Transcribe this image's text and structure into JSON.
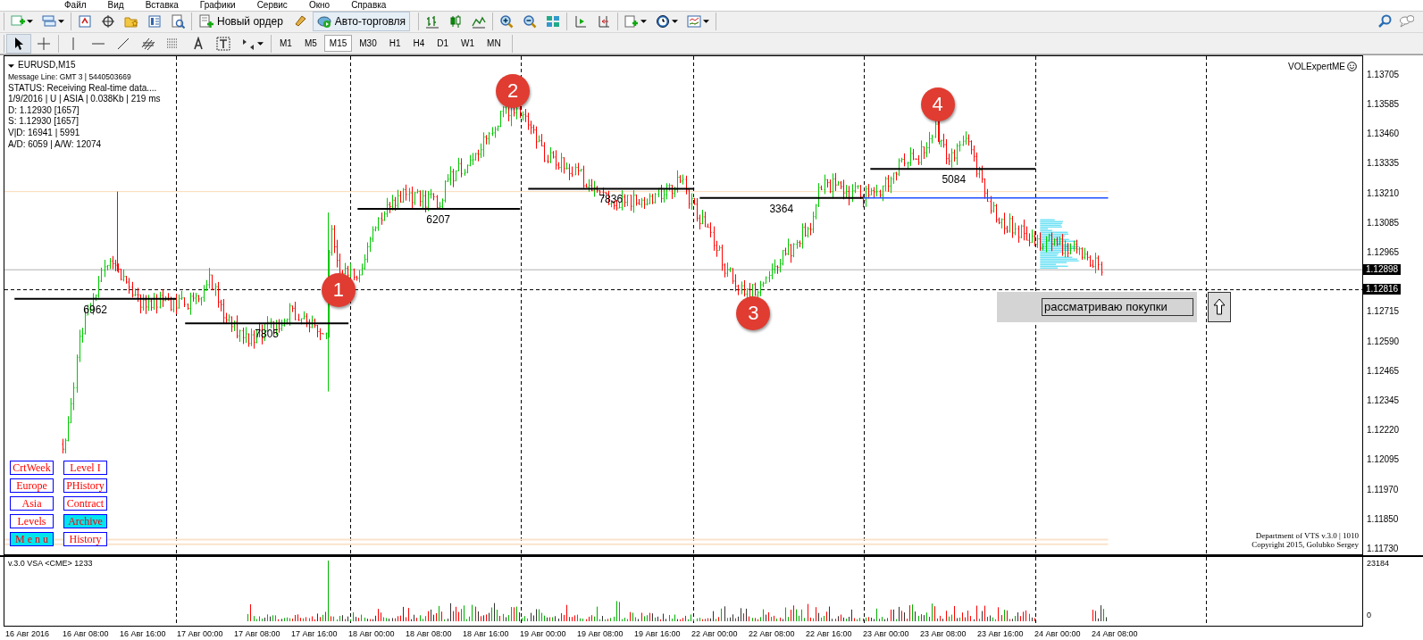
{
  "menu": [
    "Файл",
    "Вид",
    "Вставка",
    "Графики",
    "Сервис",
    "Окно",
    "Справка"
  ],
  "toolbar": {
    "new_order": "Новый ордер",
    "auto_trading": "Авто-торговля",
    "timeframes": [
      {
        "label": "M1",
        "selected": false
      },
      {
        "label": "M5",
        "selected": false
      },
      {
        "label": "M15",
        "selected": true
      },
      {
        "label": "M30",
        "selected": false
      },
      {
        "label": "H1",
        "selected": false
      },
      {
        "label": "H4",
        "selected": false
      },
      {
        "label": "D1",
        "selected": false
      },
      {
        "label": "W1",
        "selected": false
      },
      {
        "label": "MN",
        "selected": false
      }
    ]
  },
  "chart": {
    "symbol": "EURUSD,M15",
    "info_lines": [
      {
        "kind": "small",
        "text": "Message Line: GMT 3 | 5440503669"
      },
      {
        "kind": "normal",
        "text": "STATUS:  Receiving Real-time data...."
      },
      {
        "kind": "normal",
        "text": "1/9/2016 | U | ASIA | 0.038Kb | 219 ms"
      },
      {
        "kind": "normal",
        "text": "D: 1.12930  [1657]"
      },
      {
        "kind": "normal",
        "text": "S: 1.12930  [1657]"
      },
      {
        "kind": "normal",
        "text": "V|D: 16941 | 5991"
      },
      {
        "kind": "normal",
        "text": "A/D: 6059 | A/W: 12074"
      }
    ],
    "indicator": "VOLExpertME",
    "credits": [
      "Department of VTS  v.3.0 | 1010",
      "Copyright 2015, Golubko Sergey"
    ],
    "price_ticks": [
      "1.13705",
      "1.13585",
      "1.13460",
      "1.13335",
      "1.13210",
      "1.13085",
      "1.12965",
      "1.12715",
      "1.12590",
      "1.12465",
      "1.12345",
      "1.12220",
      "1.12095",
      "1.11970",
      "1.11850",
      "1.11730"
    ],
    "current_price": "1.12898",
    "line_price": "1.12816",
    "levels": [
      "6962",
      "7805",
      "6207",
      "7836",
      "3364",
      "5084"
    ],
    "markers": [
      "1",
      "2",
      "3",
      "4"
    ],
    "note": {
      "value": "рассматриваю покупки"
    },
    "buttons": [
      {
        "label": "CrtWeek",
        "active": false
      },
      {
        "label": "Level I",
        "active": false
      },
      {
        "label": "Europe",
        "active": false
      },
      {
        "label": "PHistory",
        "active": false
      },
      {
        "label": "Asia",
        "active": false
      },
      {
        "label": "Contract",
        "active": false
      },
      {
        "label": "Levels",
        "active": false
      },
      {
        "label": "Archive",
        "active": true
      },
      {
        "label": "M e n u",
        "active": true
      },
      {
        "label": "History",
        "active": false
      }
    ]
  },
  "volume": {
    "title": "v.3.0 VSA <CME> 1233",
    "max": "23184",
    "min": "0"
  },
  "time_axis": [
    "16 Авг 2016",
    "16 Авг 08:00",
    "16 Авг 16:00",
    "17 Авг 00:00",
    "17 Авг 08:00",
    "17 Авг 16:00",
    "18 Авг 00:00",
    "18 Авг 08:00",
    "18 Авг 16:00",
    "19 Авг 00:00",
    "19 Авг 08:00",
    "19 Авг 16:00",
    "22 Авг 00:00",
    "22 Авг 08:00",
    "22 Авг 16:00",
    "23 Авг 00:00",
    "23 Авг 08:00",
    "23 Авг 16:00",
    "24 Авг 00:00",
    "24 Авг 08:00"
  ]
}
